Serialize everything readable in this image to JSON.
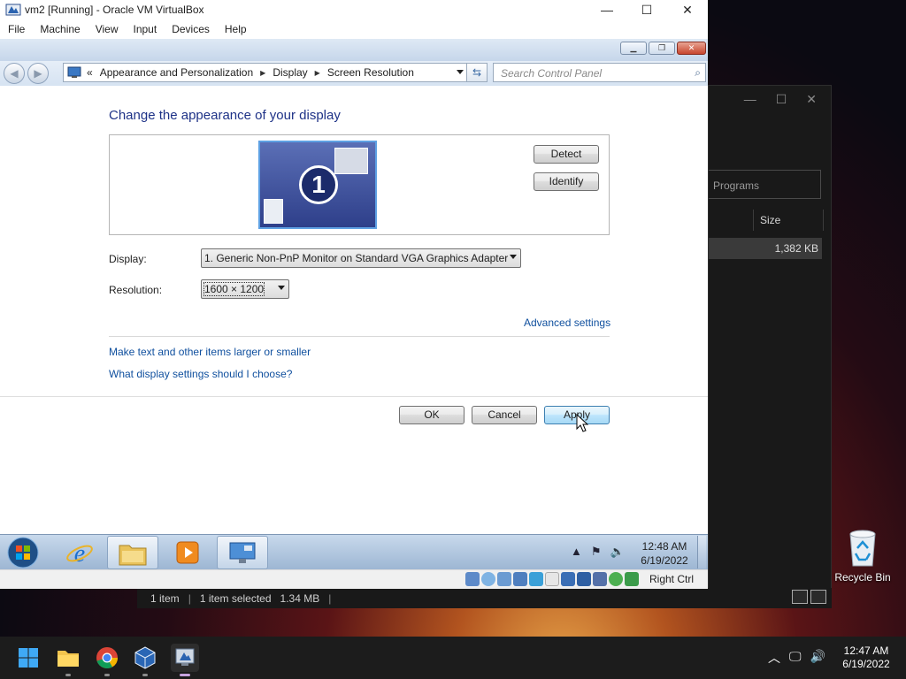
{
  "vbox": {
    "title": "vm2 [Running] - Oracle VM VirtualBox",
    "menu": [
      "File",
      "Machine",
      "View",
      "Input",
      "Devices",
      "Help"
    ],
    "minimize_glyph": "—",
    "maximize_glyph": "☐",
    "close_glyph": "✕",
    "status_host_key": "Right Ctrl"
  },
  "guest_window": {
    "back_glyph": "◀",
    "forward_glyph": "▶",
    "breadcrumb_prefix": "«",
    "breadcrumb": [
      "Appearance and Personalization",
      "Display",
      "Screen Resolution"
    ],
    "search_placeholder": "Search Control Panel",
    "heading": "Change the appearance of your display",
    "monitor_number": "1",
    "detect": "Detect",
    "identify": "Identify",
    "display_label": "Display:",
    "display_value": "1. Generic Non-PnP Monitor on Standard VGA Graphics Adapter",
    "resolution_label": "Resolution:",
    "resolution_value": "1600 × 1200",
    "advanced_settings": "Advanced settings",
    "link_text_size": "Make text and other items larger or smaller",
    "link_display_settings": "What display settings should I choose?",
    "ok": "OK",
    "cancel": "Cancel",
    "apply": "Apply"
  },
  "guest_taskbar": {
    "time": "12:48 AM",
    "date": "6/19/2022"
  },
  "background_explorer": {
    "search_text": "Programs",
    "size_header": "Size",
    "row_size": "1,382 KB",
    "status_items": "1 item",
    "status_selected": "1 item selected",
    "status_size": "1.34 MB"
  },
  "desktop": {
    "recycle_bin": "Recycle Bin"
  },
  "host_taskbar": {
    "time": "12:47 AM",
    "date": "6/19/2022"
  },
  "colors": {
    "link": "#0f4f9e",
    "heading": "#1e3287",
    "host_taskbar": "#1c1c1c"
  }
}
